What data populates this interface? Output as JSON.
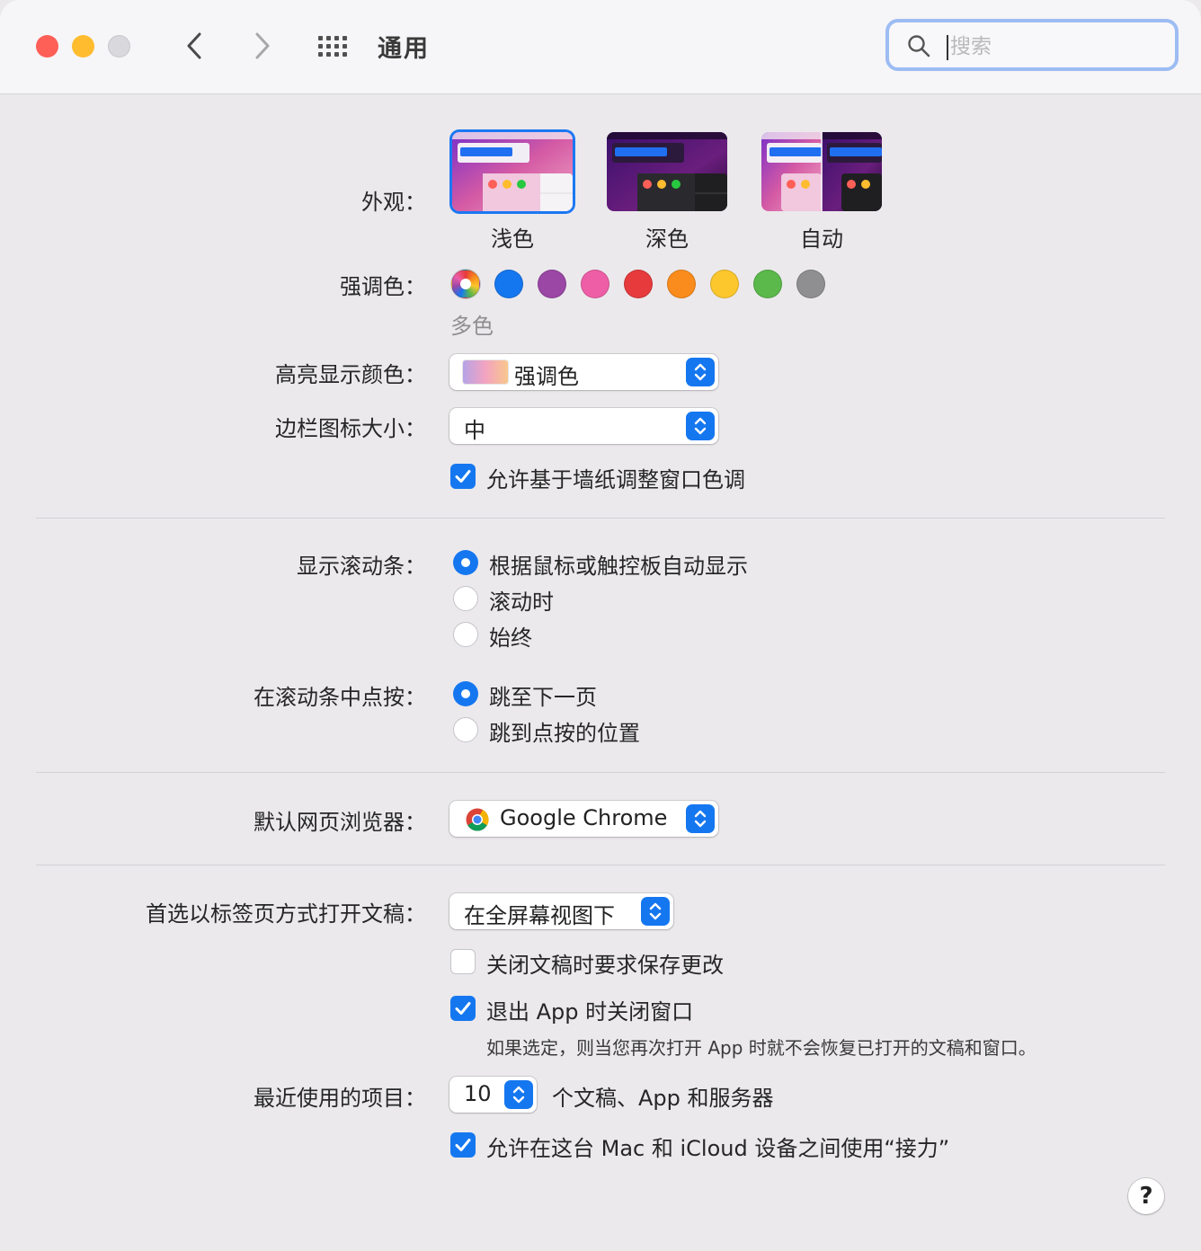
{
  "window": {
    "title": "通用",
    "search_placeholder": "搜索"
  },
  "appearance": {
    "label": "外观：",
    "options": [
      {
        "name": "浅色",
        "selected": true
      },
      {
        "name": "深色",
        "selected": false
      },
      {
        "name": "自动",
        "selected": false
      }
    ]
  },
  "accent": {
    "label": "强调色：",
    "selected_caption": "多色",
    "colors": [
      "multicolor",
      "#1577f0",
      "#9a47a6",
      "#ee5ea6",
      "#e63a3c",
      "#f98c1d",
      "#fcc72c",
      "#5bb84b",
      "#8f8e91"
    ]
  },
  "highlight": {
    "label": "高亮显示颜色：",
    "value": "强调色"
  },
  "sidebar_icon_size": {
    "label": "边栏图标大小：",
    "value": "中"
  },
  "wallpaper_tint": {
    "label": "允许基于墙纸调整窗口色调",
    "checked": true
  },
  "show_scrollbars": {
    "label": "显示滚动条：",
    "options": [
      {
        "label": "根据鼠标或触控板自动显示",
        "selected": true
      },
      {
        "label": "滚动时",
        "selected": false
      },
      {
        "label": "始终",
        "selected": false
      }
    ]
  },
  "click_scrollbar": {
    "label": "在滚动条中点按：",
    "options": [
      {
        "label": "跳至下一页",
        "selected": true
      },
      {
        "label": "跳到点按的位置",
        "selected": false
      }
    ]
  },
  "default_browser": {
    "label": "默认网页浏览器：",
    "value": "Google Chrome"
  },
  "prefer_tabs": {
    "label": "首选以标签页方式打开文稿：",
    "value": "在全屏幕视图下"
  },
  "ask_keep_changes": {
    "label": "关闭文稿时要求保存更改",
    "checked": false
  },
  "close_windows": {
    "label": "退出 App 时关闭窗口",
    "checked": true,
    "note": "如果选定，则当您再次打开 App 时就不会恢复已打开的文稿和窗口。"
  },
  "recent_items": {
    "label": "最近使用的项目：",
    "value": "10",
    "suffix": "个文稿、App 和服务器"
  },
  "handoff": {
    "label": "允许在这台 Mac 和 iCloud 设备之间使用“接力”",
    "checked": true
  },
  "help": {
    "label": "?"
  }
}
